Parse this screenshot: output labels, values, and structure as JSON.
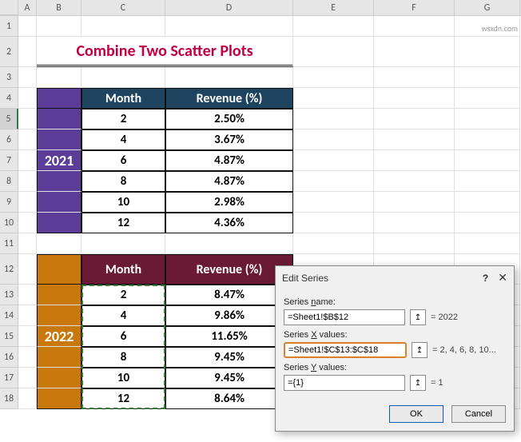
{
  "columns": [
    "A",
    "B",
    "C",
    "D",
    "E",
    "F",
    "G"
  ],
  "rows": [
    "1",
    "2",
    "3",
    "4",
    "5",
    "6",
    "7",
    "8",
    "9",
    "10",
    "11",
    "12",
    "13",
    "14",
    "15",
    "16",
    "17",
    "18"
  ],
  "title": "Combine Two Scatter Plots",
  "watermark": "wsxdn.com",
  "table1": {
    "year": "2021",
    "headers": {
      "month": "Month",
      "revenue": "Revenue (%)"
    },
    "data": [
      {
        "month": "2",
        "rev": "2.50%"
      },
      {
        "month": "4",
        "rev": "3.67%"
      },
      {
        "month": "6",
        "rev": "4.87%"
      },
      {
        "month": "8",
        "rev": "4.87%"
      },
      {
        "month": "10",
        "rev": "2.98%"
      },
      {
        "month": "12",
        "rev": "4.36%"
      }
    ]
  },
  "table2": {
    "year": "2022",
    "headers": {
      "month": "Month",
      "revenue": "Revenue (%)"
    },
    "data": [
      {
        "month": "2",
        "rev": "8.47%"
      },
      {
        "month": "4",
        "rev": "9.86%"
      },
      {
        "month": "6",
        "rev": "11.65%"
      },
      {
        "month": "8",
        "rev": "9.45%"
      },
      {
        "month": "10",
        "rev": "9.45%"
      },
      {
        "month": "12",
        "rev": "8.64%"
      }
    ]
  },
  "dialog": {
    "title": "Edit Series",
    "labels": {
      "name": "Series name:",
      "x": "Series X values:",
      "y": "Series Y values:"
    },
    "name_value": "=Sheet1!$B$12",
    "name_result": "= 2022",
    "x_value": "=Sheet1!$C$13:$C$18",
    "x_result": "= 2, 4, 6, 8, 10...",
    "y_value": "={1}",
    "y_result": "= 1",
    "ok": "OK",
    "cancel": "Cancel",
    "help": "?",
    "close": "✕",
    "ref_icon": "↥"
  },
  "chart_data": {
    "type": "scatter",
    "series": [
      {
        "name": "2021",
        "x": [
          2,
          4,
          6,
          8,
          10,
          12
        ],
        "y": [
          2.5,
          3.67,
          4.87,
          4.87,
          2.98,
          4.36
        ]
      },
      {
        "name": "2022",
        "x": [
          2,
          4,
          6,
          8,
          10,
          12
        ],
        "y": [
          8.47,
          9.86,
          11.65,
          9.45,
          9.45,
          8.64
        ]
      }
    ],
    "xlabel": "Month",
    "ylabel": "Revenue (%)"
  }
}
